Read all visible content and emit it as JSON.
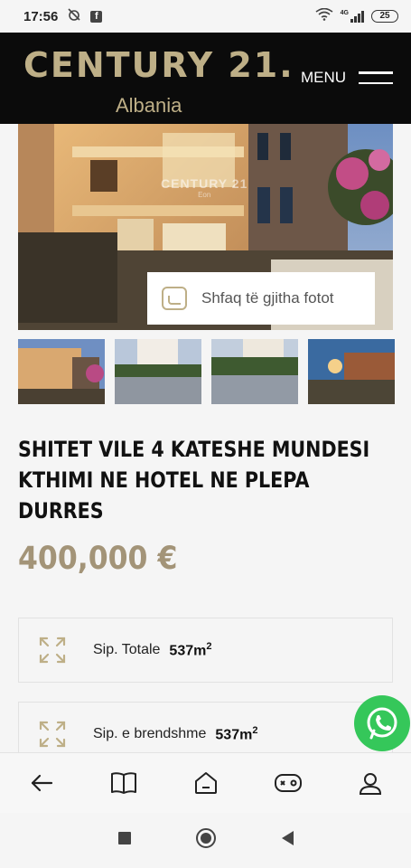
{
  "status_bar": {
    "time": "17:56",
    "battery": "25",
    "network": "4G"
  },
  "header": {
    "brand": "CENTURY 21.",
    "sub": "Albania",
    "menu_label": "MENU"
  },
  "gallery": {
    "watermark": "CENTURY 21",
    "watermark_sub": "Eon",
    "show_all_label": "Shfaq të gjitha fotot",
    "thumbnail_count": 4
  },
  "listing": {
    "title": "SHITET VILE 4 KATESHE MUNDESI KTHIMI NE HOTEL NE PLEPA DURRES",
    "price": "400,000 €",
    "features": [
      {
        "label": "Sip. Totale",
        "value": "537m",
        "unit_sup": "2"
      },
      {
        "label": "Sip. e brendshme",
        "value": "537m",
        "unit_sup": "2"
      }
    ]
  },
  "bottom_nav": {
    "items": [
      "back-icon",
      "book-icon",
      "home-icon",
      "gamepad-icon",
      "profile-icon"
    ]
  },
  "colors": {
    "accent_gold": "#beaf87",
    "price_gold": "#a39478",
    "header_bg": "#0b0b0b",
    "whatsapp_green": "#35c75a"
  }
}
